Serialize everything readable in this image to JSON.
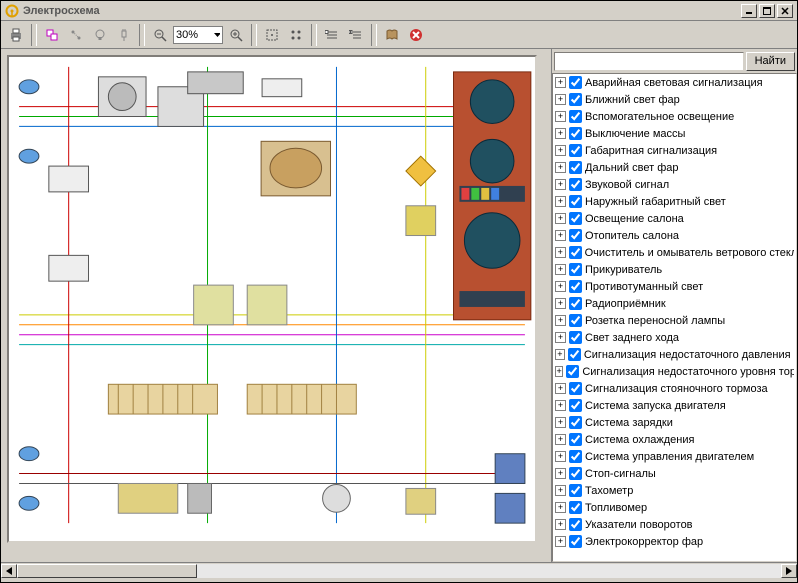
{
  "window": {
    "title": "Электросхема"
  },
  "toolbar": {
    "zoom_value": "30%"
  },
  "search": {
    "placeholder": "",
    "find_label": "Найти"
  },
  "circuits": {
    "items": [
      {
        "label": "Аварийная световая сигнализация",
        "checked": true
      },
      {
        "label": "Ближний свет фар",
        "checked": true
      },
      {
        "label": "Вспомогательное освещение",
        "checked": true
      },
      {
        "label": "Выключение массы",
        "checked": true
      },
      {
        "label": "Габаритная сигнализация",
        "checked": true
      },
      {
        "label": "Дальний свет фар",
        "checked": true
      },
      {
        "label": "Звуковой сигнал",
        "checked": true
      },
      {
        "label": "Наружный габаритный свет",
        "checked": true
      },
      {
        "label": "Освещение салона",
        "checked": true
      },
      {
        "label": "Отопитель салона",
        "checked": true
      },
      {
        "label": "Очиститель и омыватель ветрового стекла",
        "checked": true
      },
      {
        "label": "Прикуриватель",
        "checked": true
      },
      {
        "label": "Противотуманный свет",
        "checked": true
      },
      {
        "label": "Радиоприёмник",
        "checked": true
      },
      {
        "label": "Розетка переносной лампы",
        "checked": true
      },
      {
        "label": "Свет заднего хода",
        "checked": true
      },
      {
        "label": "Сигнализация недостаточного давления масла",
        "checked": true
      },
      {
        "label": "Сигнализация недостаточного уровня тормозной жидкости",
        "checked": true
      },
      {
        "label": "Сигнализация стояночного тормоза",
        "checked": true
      },
      {
        "label": "Система запуска двигателя",
        "checked": true
      },
      {
        "label": "Система зарядки",
        "checked": true
      },
      {
        "label": "Система охлаждения",
        "checked": true
      },
      {
        "label": "Система управления двигателем",
        "checked": true
      },
      {
        "label": "Стоп-сигналы",
        "checked": true
      },
      {
        "label": "Тахометр",
        "checked": true
      },
      {
        "label": "Топливомер",
        "checked": true
      },
      {
        "label": "Указатели поворотов",
        "checked": true
      },
      {
        "label": "Электрокорректор фар",
        "checked": true
      }
    ]
  }
}
